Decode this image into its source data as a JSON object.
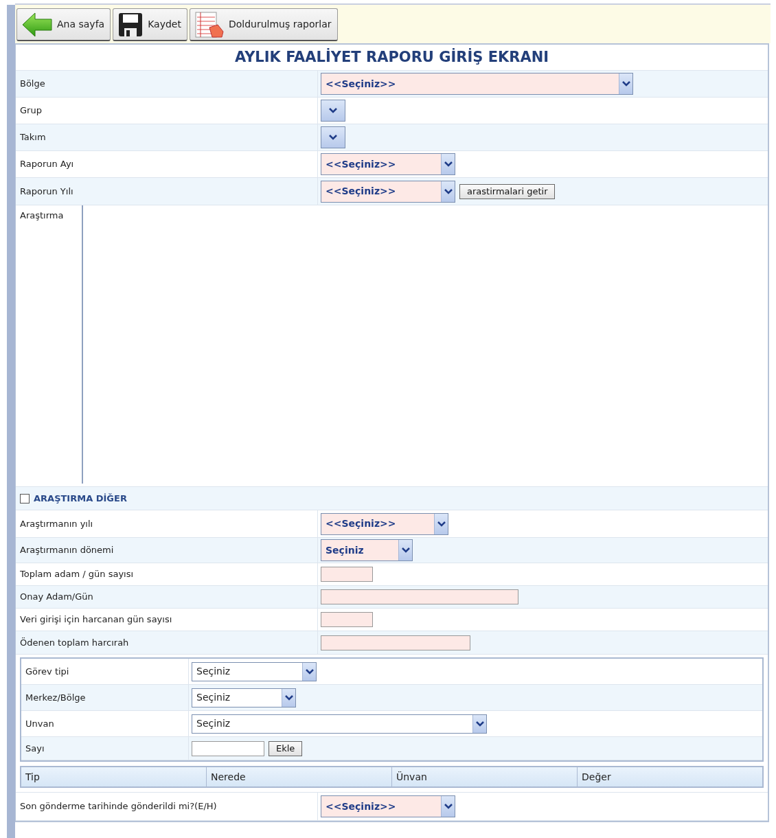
{
  "toolbar": [
    {
      "label": "Ana sayfa",
      "kind": "back"
    },
    {
      "label": "Kaydet",
      "kind": "save"
    },
    {
      "label": "Doldurulmuş raporlar",
      "kind": "report"
    }
  ],
  "title": "AYLIK FAALİYET RAPORU GİRİŞ EKRANI",
  "fields": [
    {
      "label": "Bölge",
      "kind": "select",
      "value": "<<Seçiniz>>"
    },
    {
      "label": "Grup",
      "kind": "select"
    },
    {
      "label": "Takım",
      "kind": "select"
    },
    {
      "label": "Raporun Ayı",
      "kind": "select",
      "value": "<<Seçiniz>>"
    },
    {
      "label": "Raporun Yılı",
      "kind": "select",
      "value": "<<Seçiniz>>",
      "button": "arastirmalari getir"
    },
    {
      "label": "Araştırma",
      "kind": "listbox"
    }
  ],
  "other_toggle": {
    "label": "ARAŞTIRMA DİĞER",
    "checked": false
  },
  "other_fields": [
    {
      "label": "Araştırmanın yılı",
      "kind": "select",
      "value": "<<Seçiniz>>"
    },
    {
      "label": "Araştırmanın dönemi",
      "kind": "select",
      "value": "Seçiniz"
    },
    {
      "label": "Toplam adam / gün sayısı",
      "kind": "text"
    },
    {
      "label": "Onay Adam/Gün",
      "kind": "text"
    },
    {
      "label": "Veri girişi için harcanan gün sayısı",
      "kind": "text"
    },
    {
      "label": "Ödenen toplam harcırah",
      "kind": "text"
    }
  ],
  "staff_panel": [
    {
      "label": "Görev tipi",
      "kind": "select",
      "value": "Seçiniz"
    },
    {
      "label": "Merkez/Bölge",
      "kind": "select",
      "value": "Seçiniz"
    },
    {
      "label": "Unvan",
      "kind": "select",
      "value": "Seçiniz"
    },
    {
      "label": "Sayı",
      "kind": "text",
      "button": "Ekle"
    }
  ],
  "staff_table": {
    "columns": [
      "Tip",
      "Nerede",
      "Ünvan",
      "Değer"
    ]
  },
  "final_field": {
    "label": "Son gönderme tarihinde gönderildi mi?(E/H)",
    "kind": "select",
    "value": "<<Seçiniz>>"
  }
}
